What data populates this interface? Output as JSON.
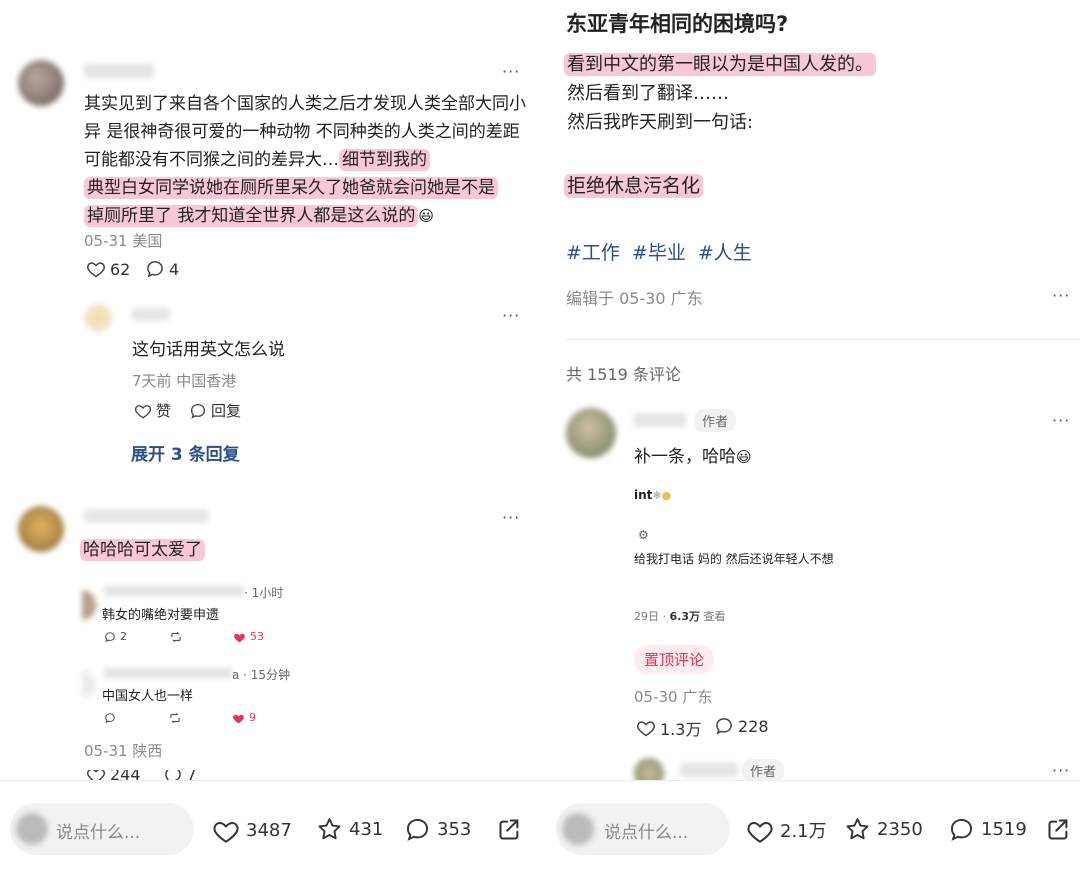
{
  "left": {
    "comment1": {
      "text_plain": "其实见到了来自各个国家的人类之后才发现人类全部大同小异 是很神奇很可爱的一种动物 不同种类的人类之间的差距可能都没有不同猴之间的差异大…",
      "text_hl1": "细节到我的",
      "text_hl2": "典型白女同学说她在厕所里呆久了她爸就会问她是不是",
      "text_hl3": "掉厕所里了 我才知道全世界人都是这么说的",
      "emoji": "😃",
      "date_loc": "05-31 美国",
      "likes": "62",
      "replies": "4",
      "more": "···"
    },
    "reply1": {
      "text": "这句话用英文怎么说",
      "date_loc": "7天前 中国香港",
      "like_label": "赞",
      "reply_label": "回复",
      "expand": "展开 3 条回复",
      "more": "···"
    },
    "comment2": {
      "text": "哈哈哈可太爱了",
      "more": "···",
      "embed": {
        "row1_time": "· 1小时",
        "row1_text": "韩女的嘴绝对要申遗",
        "row1_replies": "2",
        "row1_likes": "53",
        "row2_time": "a · 15分钟",
        "row2_text": "中国女人也一样",
        "row2_likes": "9"
      },
      "date_loc": "05-31 陕西",
      "likes_partial": "244",
      "replies_partial": "7"
    },
    "bottombar": {
      "placeholder": "说点什么...",
      "likes": "3487",
      "stars": "431",
      "comments": "353"
    }
  },
  "right": {
    "title": "东亚青年相同的困境吗?",
    "line1": "看到中文的第一眼以为是中国人发的。",
    "line2": "然后看到了翻译……",
    "line3": "然后我昨天刷到一句话:",
    "line4": "拒绝休息污名化",
    "tags": [
      "#工作",
      "#毕业",
      "#人生"
    ],
    "edited": "编辑于 05-30 广东",
    "more": "···",
    "comment_count": "共 1519 条评论",
    "comment1": {
      "author_badge": "作者",
      "text": "补一条，哈哈",
      "emoji": "😃",
      "img_line1": "int",
      "img_line2": "给我打电话 妈的 然后还说年轻人不想",
      "img_line3_date": "29日 · ",
      "img_line3_views": "6.3万",
      "img_line3_suffix": " 查看",
      "pinned": "置顶评论",
      "date_loc": "05-30 广东",
      "likes": "1.3万",
      "replies": "228",
      "more": "···"
    },
    "comment2": {
      "author_badge": "作者",
      "more": "···"
    },
    "bottombar": {
      "placeholder": "说点什么...",
      "likes": "2.1万",
      "stars": "2350",
      "comments": "1519"
    }
  },
  "colors": {
    "highlight": "#f8c8d6",
    "link_blue": "#2b4f8a",
    "pinned_red": "#e8344e",
    "like_red": "#e8345a"
  }
}
